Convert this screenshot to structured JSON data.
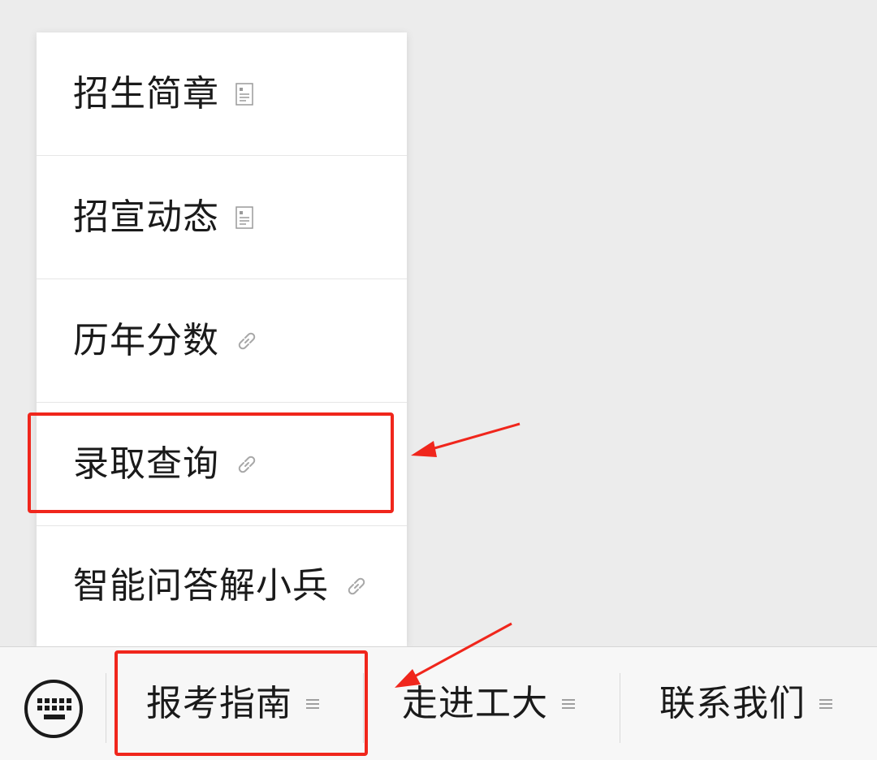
{
  "menu": {
    "items": [
      {
        "label": "招生简章",
        "icon": "article-icon"
      },
      {
        "label": "招宣动态",
        "icon": "article-icon"
      },
      {
        "label": "历年分数",
        "icon": "link-icon"
      },
      {
        "label": "录取查询",
        "icon": "link-icon"
      },
      {
        "label": "智能问答解小兵",
        "icon": "link-icon"
      }
    ]
  },
  "bottom_bar": {
    "keyboard_icon": "keyboard-icon",
    "tabs": [
      {
        "label": "报考指南",
        "icon": "menu-lines-icon"
      },
      {
        "label": "走进工大",
        "icon": "menu-lines-icon"
      },
      {
        "label": "联系我们",
        "icon": "menu-lines-icon"
      }
    ]
  },
  "colors": {
    "annotation": "#f0261c",
    "background": "#ececec",
    "menu_background": "#ffffff",
    "icon_gray": "#9a9a9a"
  }
}
